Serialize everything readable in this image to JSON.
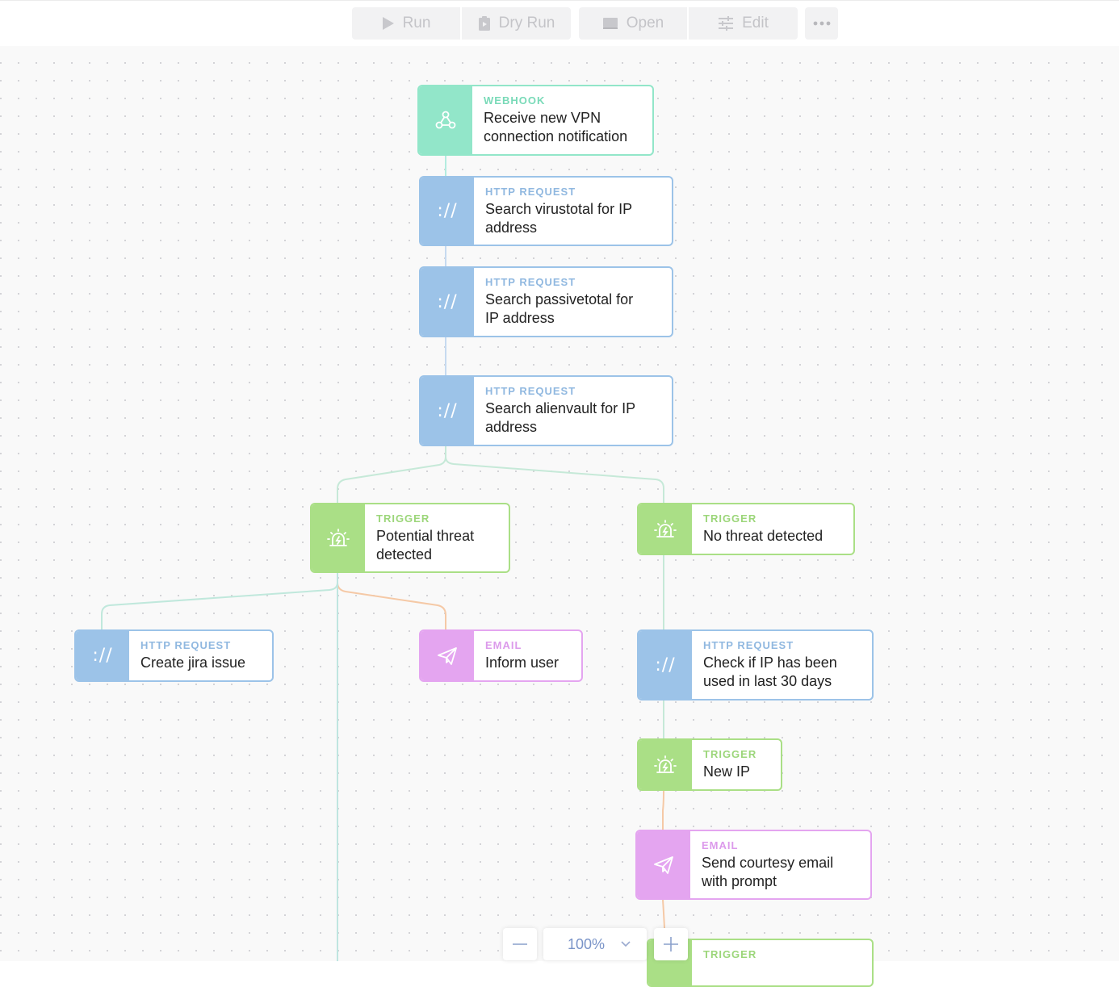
{
  "toolbar": {
    "run_label": "Run",
    "dry_run_label": "Dry Run",
    "open_label": "Open",
    "edit_label": "Edit",
    "more_icon": "more-horizontal-icon"
  },
  "nodes": {
    "webhook": {
      "type": "WEBHOOK",
      "title_line1": "Receive new VPN",
      "title_line2": "connection notification"
    },
    "virustotal": {
      "type": "HTTP REQUEST",
      "title_line1": "Search virustotal for IP",
      "title_line2": "address"
    },
    "passivetotal": {
      "type": "HTTP REQUEST",
      "title_line1": "Search passivetotal for",
      "title_line2": "IP address"
    },
    "alienvault": {
      "type": "HTTP REQUEST",
      "title_line1": "Search alienvault for IP",
      "title_line2": "address"
    },
    "potential_threat": {
      "type": "TRIGGER",
      "title_line1": "Potential threat",
      "title_line2": "detected"
    },
    "no_threat": {
      "type": "TRIGGER",
      "title_line1": "No threat detected"
    },
    "jira": {
      "type": "HTTP REQUEST",
      "title_line1": "Create jira issue"
    },
    "inform_user": {
      "type": "EMAIL",
      "title_line1": "Inform user"
    },
    "check_ip": {
      "type": "HTTP REQUEST",
      "title_line1": "Check if IP has been",
      "title_line2": "used in last 30 days"
    },
    "new_ip": {
      "type": "TRIGGER",
      "title_line1": "New IP"
    },
    "courtesy_email": {
      "type": "EMAIL",
      "title_line1": "Send courtesy email",
      "title_line2": "with prompt"
    },
    "trigger_bottom": {
      "type": "TRIGGER"
    }
  },
  "zoom": {
    "level": "100%",
    "minus": "—",
    "plus": "+"
  },
  "colors": {
    "webhook": "#92e6c9",
    "http_request": "#9cc3e8",
    "trigger": "#aadf86",
    "email": "#e4a5f0",
    "canvas_bg": "#f9f9f9",
    "edge_webhook": "#b3ece0",
    "edge_http": "#c6daf0",
    "edge_trigger": "#c6e9b0",
    "edge_email": "#f5c9a6"
  },
  "icons": {
    "webhook": "webhook-icon",
    "http_request": "http-protocol-icon",
    "trigger": "siren-alarm-icon",
    "email": "paper-plane-icon"
  }
}
